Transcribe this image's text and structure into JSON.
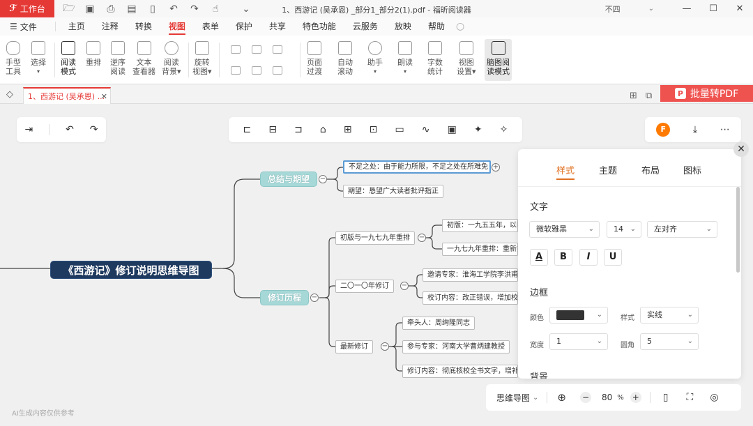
{
  "titlebar": {
    "workbench": "工作台",
    "document_title": "1、西游记 (吴承恩) _部分1_部分2(1).pdf - 福昕阅读器",
    "user": "不四",
    "min": "—",
    "max": "☐",
    "close": "✕"
  },
  "menu": {
    "file": "文件",
    "items": [
      "主页",
      "注释",
      "转换",
      "视图",
      "表单",
      "保护",
      "共享",
      "特色功能",
      "云服务",
      "放映",
      "帮助"
    ]
  },
  "ribbon": {
    "hand": [
      "手型",
      "工具"
    ],
    "select": [
      "选择"
    ],
    "read_mode": [
      "阅读",
      "模式"
    ],
    "reflow": [
      "重排"
    ],
    "reverse_read": [
      "逆序",
      "阅读"
    ],
    "text_viewer": [
      "文本",
      "查看器"
    ],
    "read_bg": [
      "阅读",
      "背景▾"
    ],
    "rotate_view": [
      "旋转",
      "视图▾"
    ],
    "page_transition": [
      "页面",
      "过渡"
    ],
    "auto_scroll": [
      "自动",
      "滚动"
    ],
    "assistant": [
      "助手"
    ],
    "read_aloud": [
      "朗读"
    ],
    "word_count": [
      "字数",
      "统计"
    ],
    "view_settings": [
      "视图",
      "设置▾"
    ],
    "mindmap_read": [
      "脑图阅",
      "读模式"
    ]
  },
  "tab": {
    "doc_name": "1、西游记 (吴承恩) ...",
    "close": "✕",
    "batch_convert": "批量转PDF"
  },
  "mindmap": {
    "root": "《西游记》修订说明思维导图",
    "summary": "总结与期望",
    "summary_children": [
      "不足之处：由于能力所限，不足之处在所难免",
      "期望：恳望广大读者批评指正"
    ],
    "history": "修订历程",
    "branches": [
      {
        "label": "初版与一九七九年重排",
        "children": [
          "初版：一九五五年，以明",
          "一九七九年重排：重新排"
        ]
      },
      {
        "label": "二〇一〇年修订",
        "children": [
          "邀请专家：淮海工学院李洪甫等",
          "校订内容：改正错误，增加校注"
        ]
      },
      {
        "label": "最新修订",
        "children": [
          "牵头人：周绚隆同志",
          "参与专家：河南大学曹炳建教授",
          "修订内容：彻底核校全书文字，增补多"
        ]
      }
    ]
  },
  "panel": {
    "tabs": [
      "样式",
      "主题",
      "布局",
      "图标"
    ],
    "text_section": "文字",
    "font": "微软雅黑",
    "size": "14",
    "align": "左对齐",
    "font_buttons": [
      "A",
      "B",
      "I",
      "U"
    ],
    "border_section": "边框",
    "color_label": "颜色",
    "style_label": "样式",
    "style_value": "实线",
    "width_label": "宽度",
    "width_value": "1",
    "radius_label": "圆角",
    "radius_value": "5",
    "bg_section": "背景",
    "border_color": "#333333"
  },
  "bottom": {
    "mode": "思维导图",
    "zoom": "80",
    "zoom_unit": "%",
    "minus": "−",
    "plus": "+",
    "disclaimer": "AI生成内容仅供参考"
  }
}
